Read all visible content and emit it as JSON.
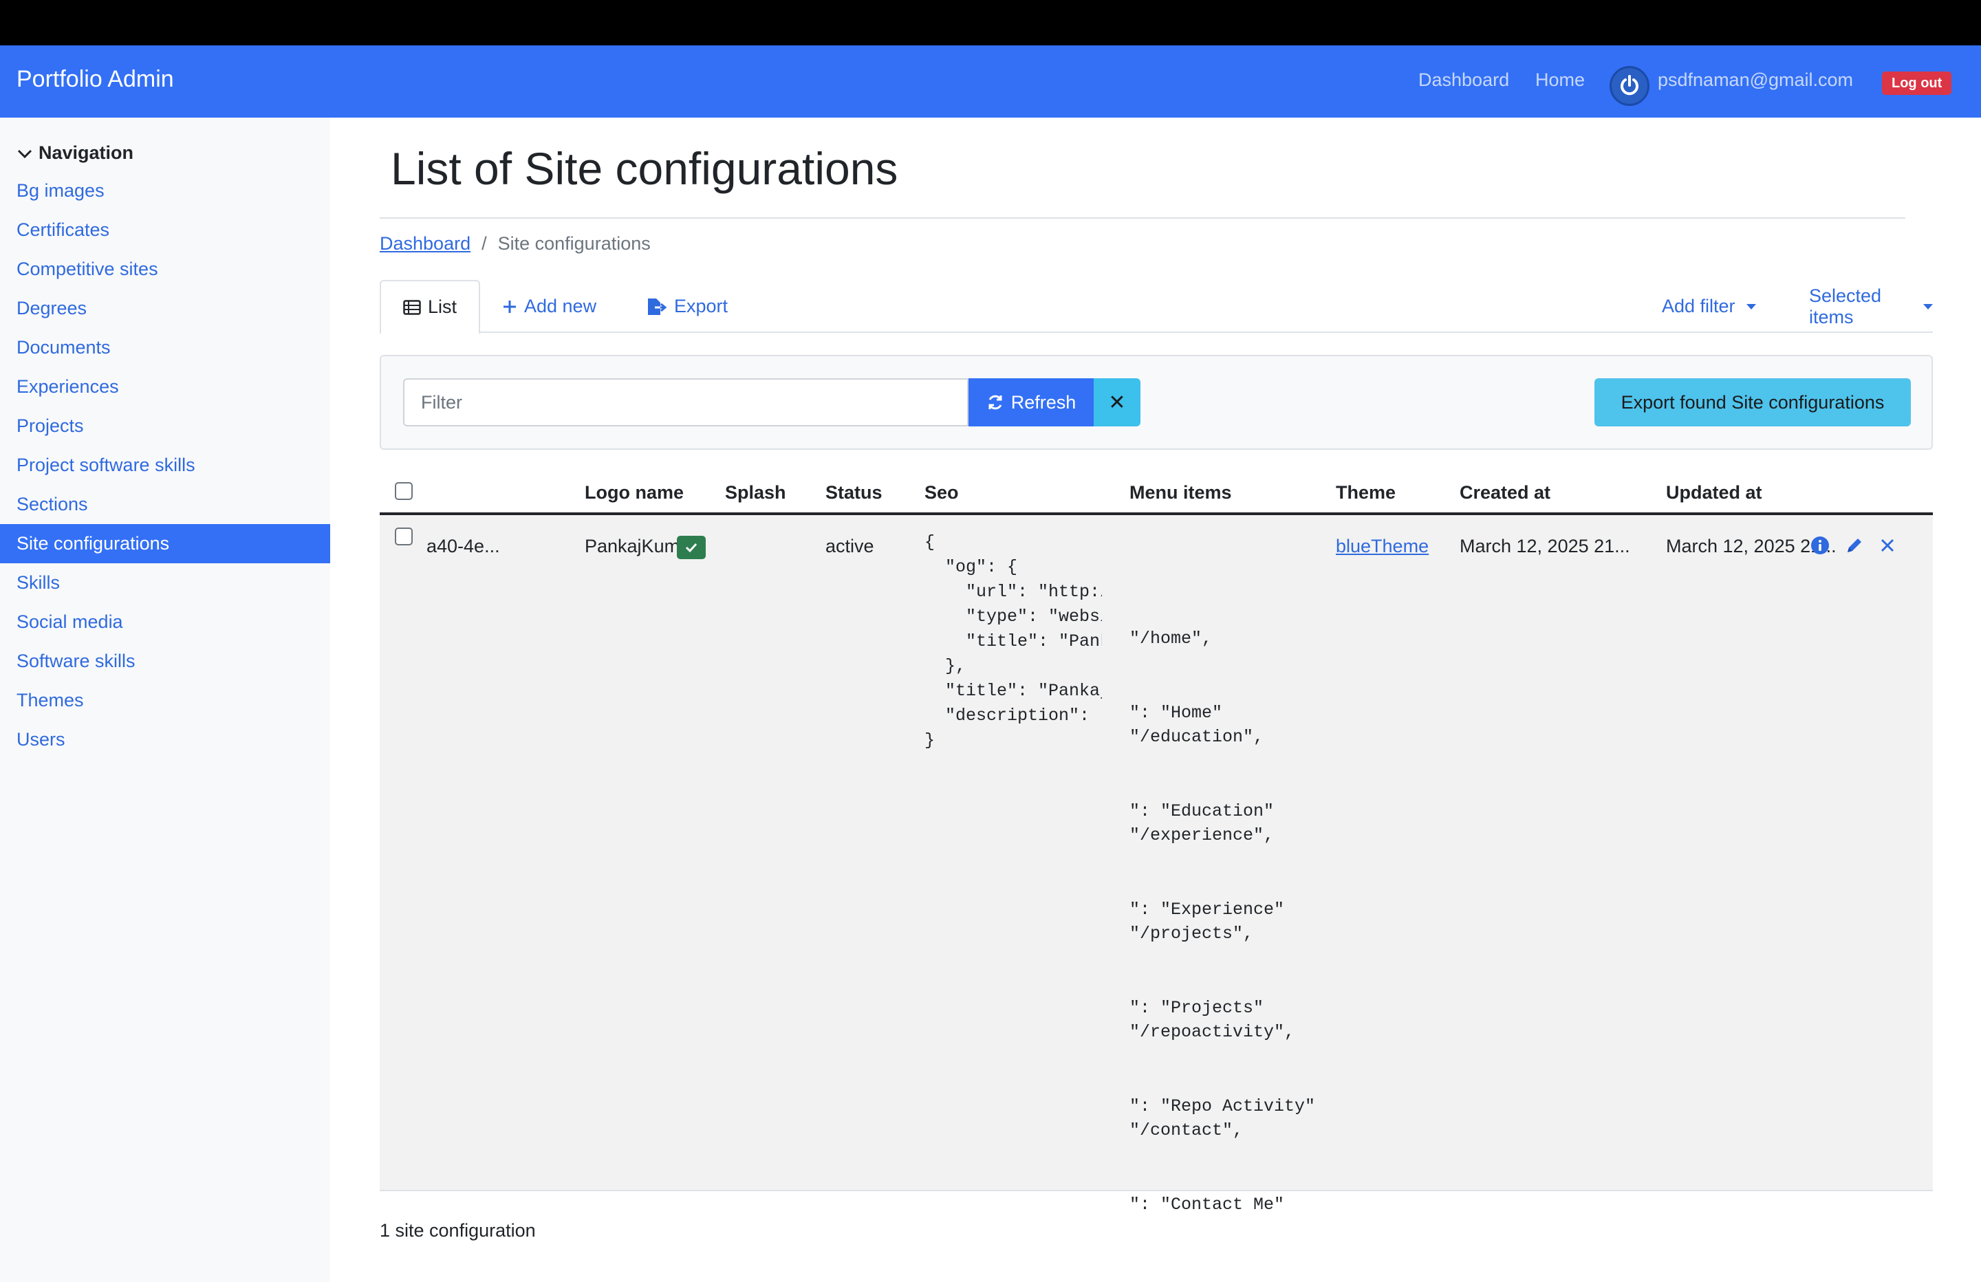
{
  "navbar": {
    "brand": "Portfolio Admin",
    "links": [
      "Dashboard",
      "Home"
    ],
    "user_email": "psdfnaman@gmail.com",
    "logout_label": "Log out"
  },
  "sidebar": {
    "heading": "Navigation",
    "items": [
      {
        "label": "Bg images"
      },
      {
        "label": "Certificates"
      },
      {
        "label": "Competitive sites"
      },
      {
        "label": "Degrees"
      },
      {
        "label": "Documents"
      },
      {
        "label": "Experiences"
      },
      {
        "label": "Projects"
      },
      {
        "label": "Project software skills"
      },
      {
        "label": "Sections"
      },
      {
        "label": "Site configurations",
        "active": true
      },
      {
        "label": "Skills"
      },
      {
        "label": "Social media"
      },
      {
        "label": "Software skills"
      },
      {
        "label": "Themes"
      },
      {
        "label": "Users"
      }
    ]
  },
  "page": {
    "title": "List of Site configurations",
    "breadcrumb": {
      "link": "Dashboard",
      "separator": "/",
      "current": "Site configurations"
    }
  },
  "tabs": {
    "list": "List",
    "add_new": "Add new",
    "export": "Export",
    "add_filter": "Add filter",
    "selected_items": "Selected items"
  },
  "filter": {
    "placeholder": "Filter",
    "value": "",
    "refresh_label": "Refresh",
    "clear_symbol": "✕",
    "export_found_label": "Export found Site configurations"
  },
  "table": {
    "columns": [
      "Logo name",
      "Splash",
      "Status",
      "Seo",
      "Menu items",
      "Theme",
      "Created at",
      "Updated at"
    ],
    "rows": [
      {
        "id": "a40-4e...",
        "logo_name": "PankajKumar",
        "splash": true,
        "status": "active",
        "seo": "{\n  \"og\": {\n    \"url\": \"http:/\n    \"type\": \"websi\n    \"title\": \"Pank\n  },\n  \"title\": \"Pankaj\n  \"description\": \"",
        "seo_close": "}",
        "menu_items": [
          {
            "path": "\"/home\",",
            "label": "\": \"Home\""
          },
          {
            "path": "\"/education\",",
            "label": "\": \"Education\""
          },
          {
            "path": "\"/experience\",",
            "label": "\": \"Experience\""
          },
          {
            "path": "\"/projects\",",
            "label": "\": \"Projects\""
          },
          {
            "path": "\"/repoactivity\",",
            "label": "\": \"Repo Activity\""
          },
          {
            "path": "\"/contact\",",
            "label": "\": \"Contact Me\""
          }
        ],
        "theme": "blueTheme",
        "created_at": "March 12, 2025 21...",
        "updated_at": "March 12, 2025 21..."
      }
    ]
  },
  "footer": {
    "count_text": "1 site configuration"
  },
  "colors": {
    "primary": "#3370f5",
    "link": "#2f6adf",
    "danger": "#dc3545",
    "info": "#4ec3ec",
    "success": "#2e7d4f"
  },
  "icons": [
    "power-icon",
    "chevron-down-icon",
    "list-icon",
    "plus-icon",
    "export-file-icon",
    "refresh-icon",
    "close-icon",
    "check-icon",
    "info-icon",
    "pencil-icon"
  ]
}
